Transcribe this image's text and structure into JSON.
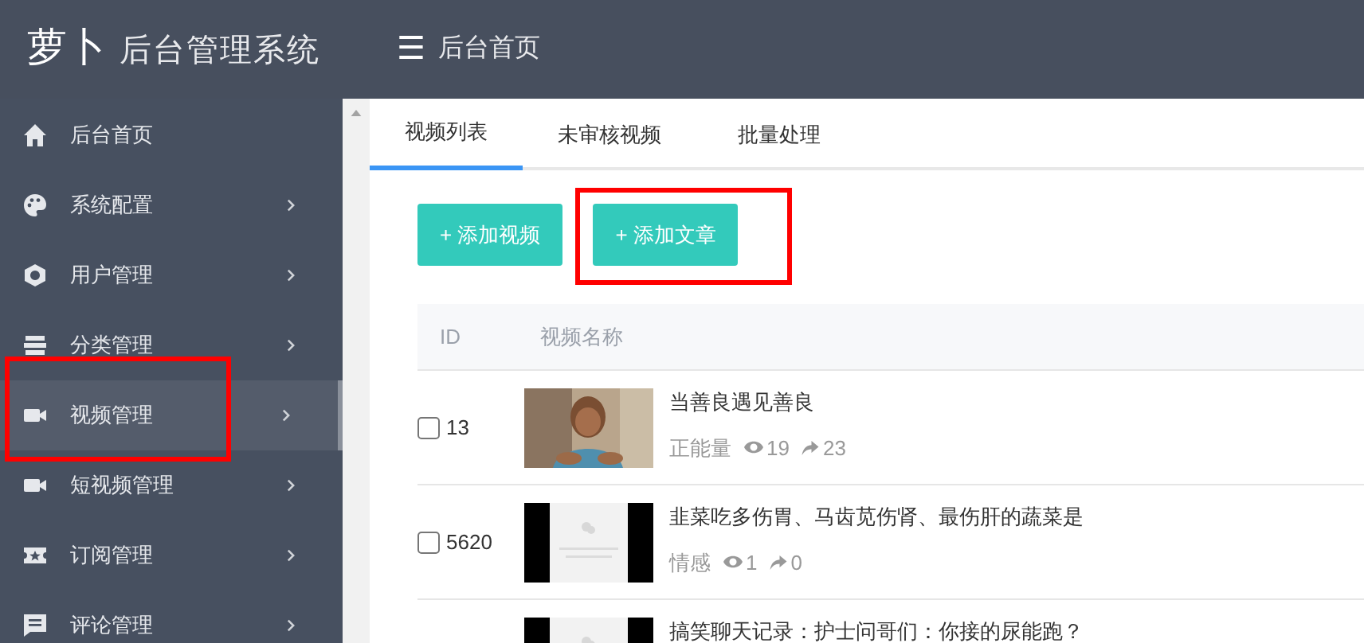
{
  "header": {
    "logo": "萝卜",
    "title": "后台管理系统",
    "menu_icon": "☰",
    "page_title": "后台首页"
  },
  "sidebar": {
    "items": [
      {
        "label": "后台首页",
        "has_arrow": false,
        "selected": false,
        "highlighted": false
      },
      {
        "label": "系统配置",
        "has_arrow": true,
        "selected": false,
        "highlighted": false
      },
      {
        "label": "用户管理",
        "has_arrow": true,
        "selected": false,
        "highlighted": false
      },
      {
        "label": "分类管理",
        "has_arrow": true,
        "selected": false,
        "highlighted": false
      },
      {
        "label": "视频管理",
        "has_arrow": true,
        "selected": true,
        "highlighted": true
      },
      {
        "label": "短视频管理",
        "has_arrow": true,
        "selected": false,
        "highlighted": false
      },
      {
        "label": "订阅管理",
        "has_arrow": true,
        "selected": false,
        "highlighted": false
      },
      {
        "label": "评论管理",
        "has_arrow": true,
        "selected": false,
        "highlighted": false
      }
    ]
  },
  "tabs": [
    {
      "label": "视频列表",
      "selected": true
    },
    {
      "label": "未审核视频",
      "selected": false
    },
    {
      "label": "批量处理",
      "selected": false
    }
  ],
  "buttons": [
    {
      "label": "+ 添加视频",
      "highlighted": false
    },
    {
      "label": "+ 添加文章",
      "highlighted": true
    }
  ],
  "table": {
    "columns": [
      "ID",
      "视频名称"
    ],
    "rows": [
      {
        "checked": false,
        "id": "13",
        "title": "当善良遇见善良",
        "category": "正能量",
        "views": "19",
        "shares": "23"
      },
      {
        "checked": false,
        "id": "5620",
        "title": "韭菜吃多伤胃、马齿苋伤肾、最伤肝的蔬菜是",
        "category": "情感",
        "views": "1",
        "shares": "0"
      },
      {
        "title": "搞笑聊天记录：护士问哥们：你接的尿能跑？"
      }
    ]
  }
}
